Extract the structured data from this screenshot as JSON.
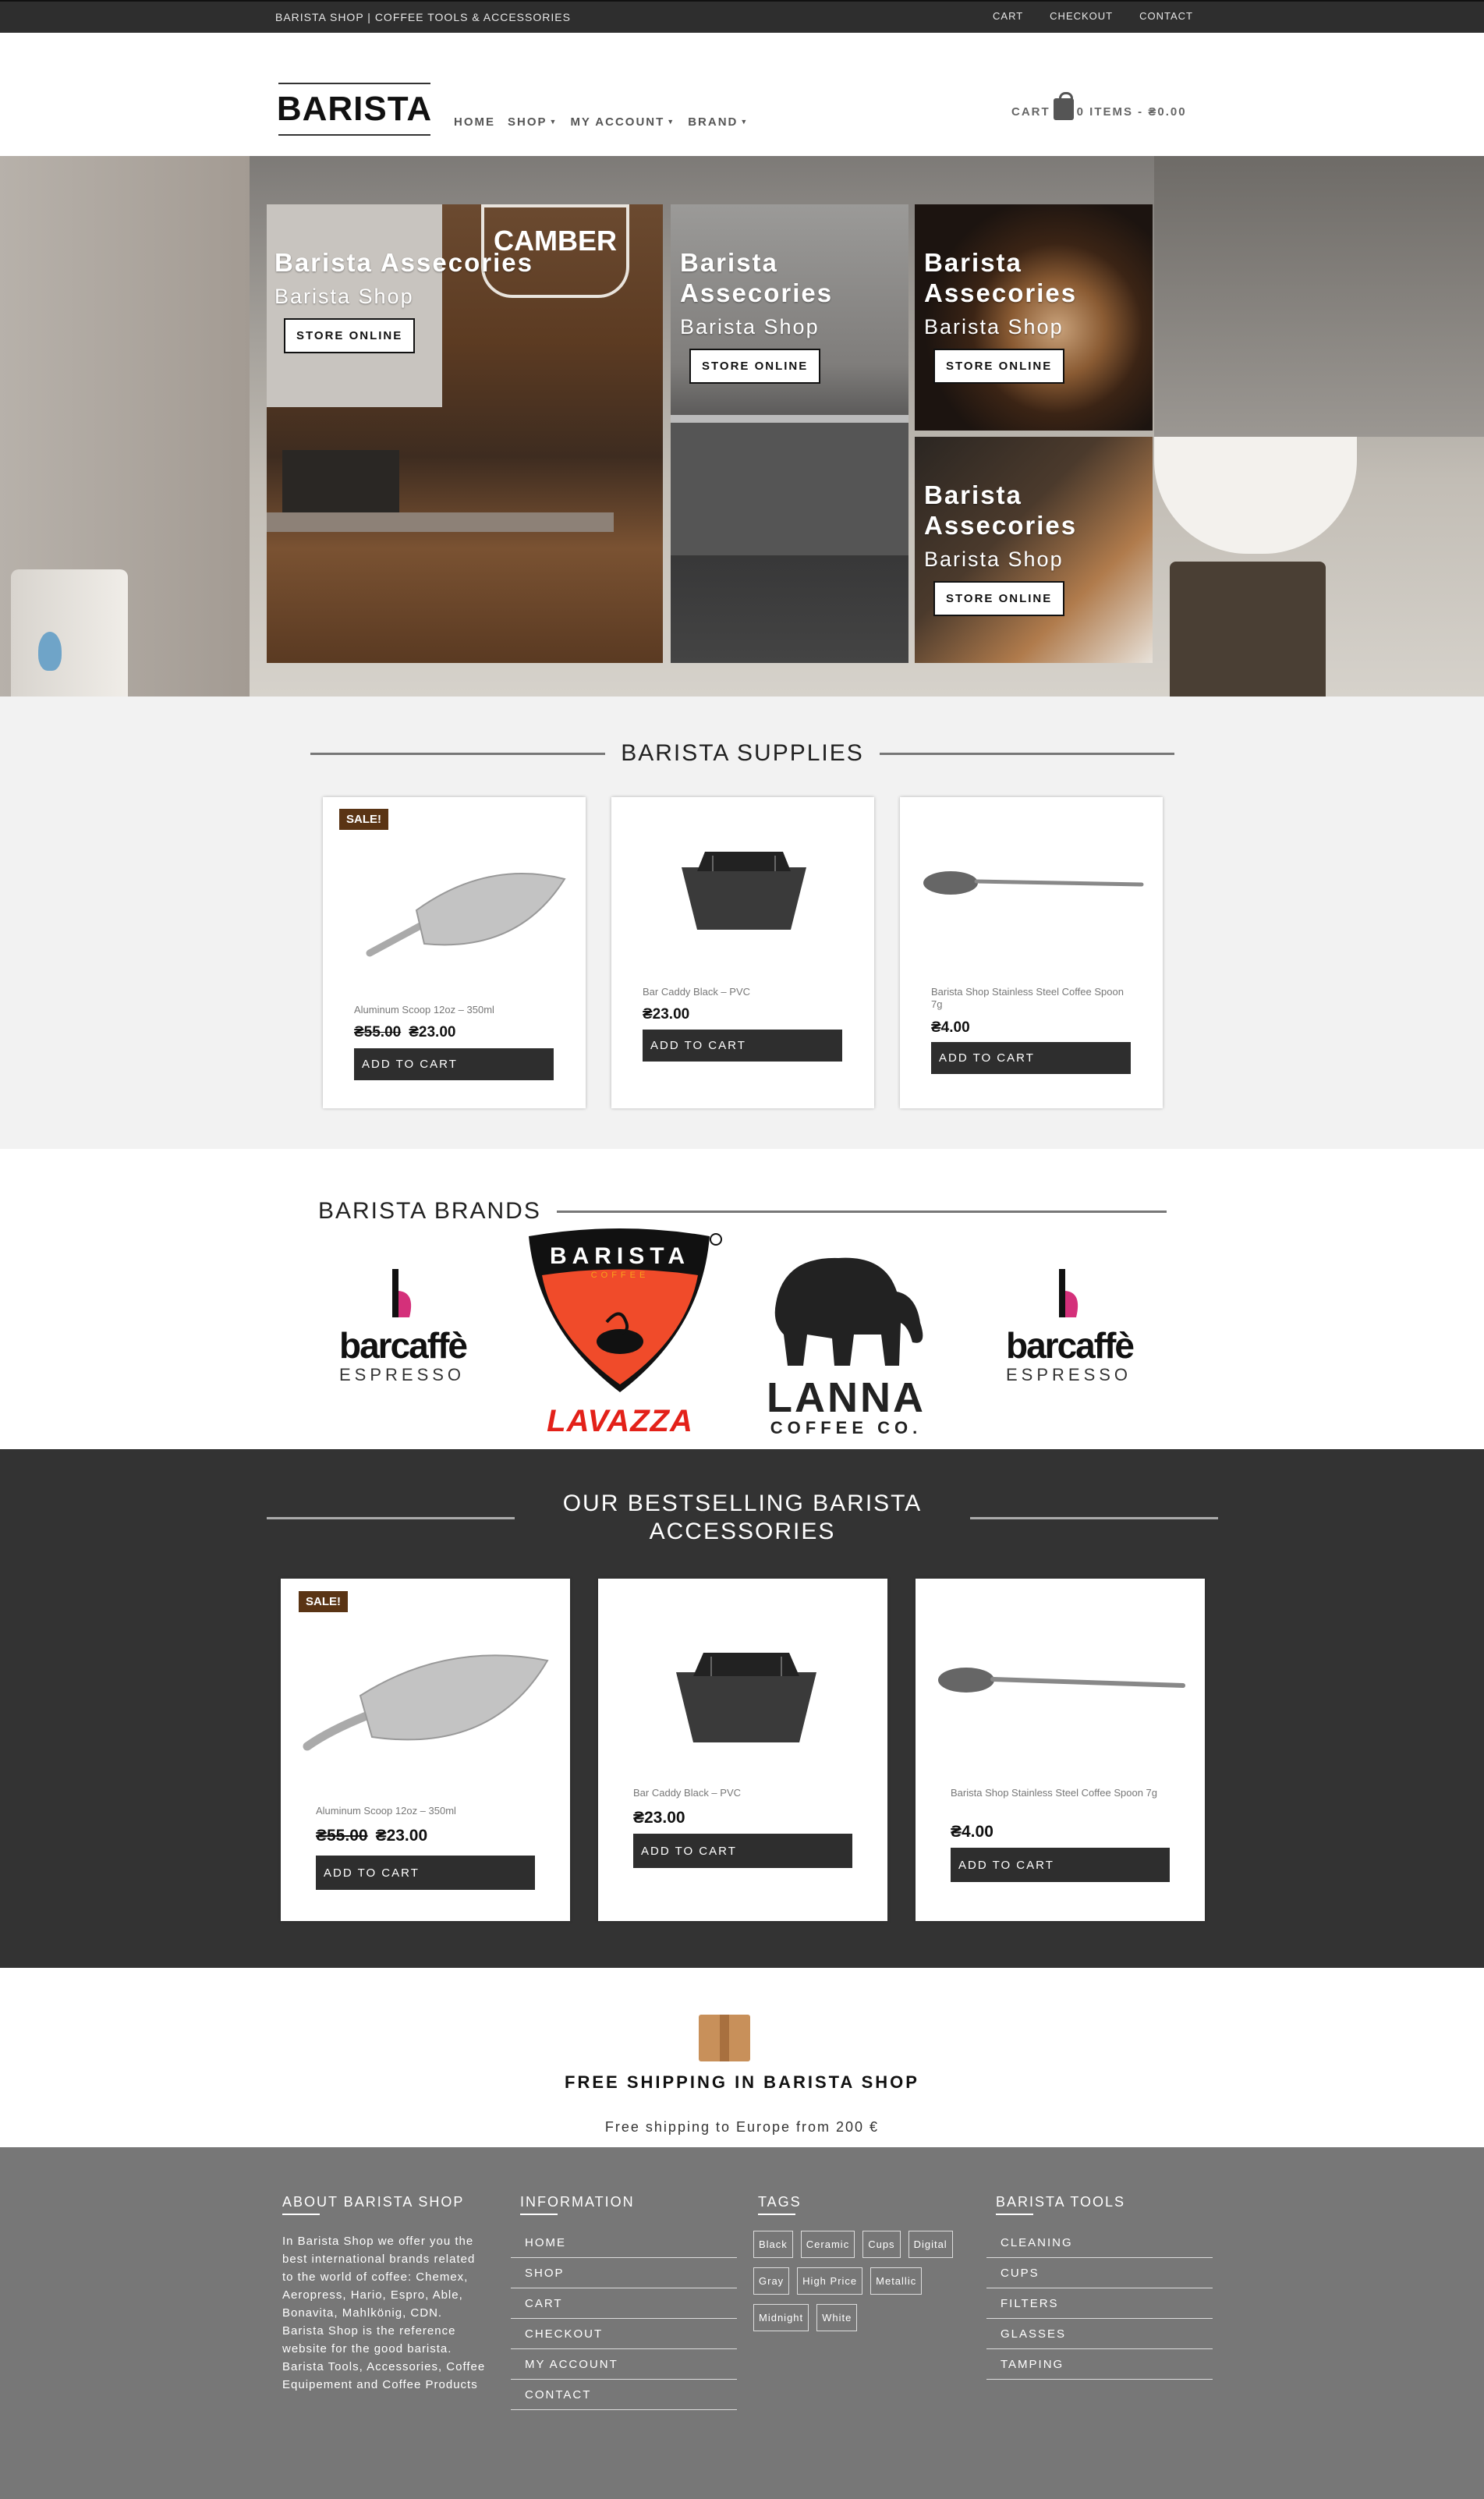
{
  "topbar": {
    "site": "BARISTA SHOP | COFFEE TOOLS & ACCESSORIES",
    "links": [
      "CART",
      "CHECKOUT",
      "CONTACT"
    ]
  },
  "header": {
    "logo": "BARISTA",
    "nav": [
      "HOME",
      "SHOP",
      "MY ACCOUNT",
      "BRAND"
    ],
    "cart_label": "CART",
    "cart_summary": "0 ITEMS - ₴0.00"
  },
  "hero": {
    "tiles": [
      {
        "title": "Barista Assecories",
        "subtitle": "Barista Shop",
        "button": "STORE ONLINE"
      },
      {
        "title": "Barista Assecories",
        "subtitle": "Barista Shop",
        "button": "STORE ONLINE"
      },
      {
        "title": "Barista Assecories",
        "subtitle": "Barista Shop",
        "button": "STORE ONLINE"
      },
      {
        "title": "Barista Assecories",
        "subtitle": "Barista Shop",
        "button": "STORE ONLINE"
      }
    ],
    "camber_sign": "CAMBER"
  },
  "supplies": {
    "title": "BARISTA SUPPLIES",
    "products": [
      {
        "badge": "SALE!",
        "name": "Aluminum Scoop 12oz – 350ml",
        "old_price": "₴55.00",
        "price": "₴23.00",
        "button": "ADD TO CART"
      },
      {
        "name": "Bar Caddy Black – PVC",
        "price": "₴23.00",
        "button": "ADD TO CART"
      },
      {
        "name": "Barista Shop Stainless Steel Coffee Spoon 7g",
        "price": "₴4.00",
        "button": "ADD TO CART"
      }
    ]
  },
  "brands": {
    "title": "BARISTA BRANDS",
    "logos": [
      {
        "name": "barcaffè",
        "tagline": "ESPRESSO"
      },
      {
        "name": "BARISTA",
        "sub": "COFFEE",
        "brand": "LAVAZZA"
      },
      {
        "name": "LANNA",
        "tagline": "COFFEE CO."
      },
      {
        "name": "barcaffè",
        "tagline": "ESPRESSO"
      }
    ]
  },
  "bestselling": {
    "title": "OUR BESTSELLING BARISTA ACCESSORIES",
    "products": [
      {
        "badge": "SALE!",
        "name": "Aluminum Scoop 12oz – 350ml",
        "old_price": "₴55.00",
        "price": "₴23.00",
        "button": "ADD TO CART"
      },
      {
        "name": "Bar Caddy Black – PVC",
        "price": "₴23.00",
        "button": "ADD TO CART"
      },
      {
        "name": "Barista Shop Stainless Steel Coffee Spoon 7g",
        "price": "₴4.00",
        "button": "ADD TO CART"
      }
    ]
  },
  "shipping": {
    "title": "FREE SHIPPING IN BARISTA SHOP",
    "text": "Free shipping to Europe from 200 €"
  },
  "footer": {
    "about": {
      "title": "ABOUT BARISTA SHOP",
      "text": "In Barista Shop we offer you the best international brands related to the world of coffee: Chemex, Aeropress, Hario, Espro, Able, Bonavita, Mahlkönig, CDN. Barista Shop is the reference website for the good barista. Barista Tools, Accessories, Coffee Equipement and Coffee Products"
    },
    "information": {
      "title": "INFORMATION",
      "links": [
        "HOME",
        "SHOP",
        "CART",
        "CHECKOUT",
        "MY ACCOUNT",
        "CONTACT"
      ]
    },
    "tags": {
      "title": "TAGS",
      "items": [
        "Black",
        "Ceramic",
        "Cups",
        "Digital",
        "Gray",
        "High Price",
        "Metallic",
        "Midnight",
        "White"
      ]
    },
    "tools": {
      "title": "BARISTA TOOLS",
      "links": [
        "CLEANING",
        "CUPS",
        "FILTERS",
        "GLASSES",
        "TAMPING"
      ]
    }
  }
}
